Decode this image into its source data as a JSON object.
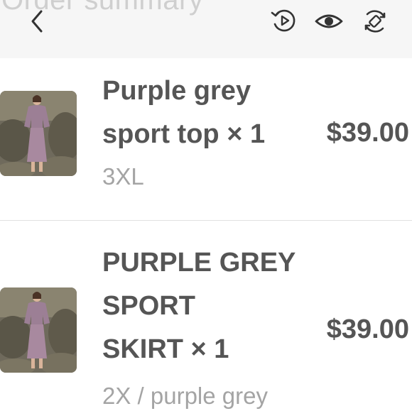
{
  "header": {
    "title": "Order summary",
    "icons": [
      "back-icon",
      "replay-icon",
      "eye-icon",
      "rotate-icon"
    ]
  },
  "items": [
    {
      "name_line1": "Purple grey",
      "name_line2": "sport top × 1",
      "variant": "3XL",
      "price": "$39.00"
    },
    {
      "name_line1": "PURPLE GREY",
      "name_line2": "SPORT",
      "name_line3": "SKIRT × 1",
      "variant": "2X / purple grey",
      "price": "$39.00"
    }
  ],
  "colors": {
    "header_bg": "#f6f6f6",
    "text_primary": "#555555",
    "text_secondary": "#a4a4a4",
    "product_purple": "#9c7f95"
  }
}
